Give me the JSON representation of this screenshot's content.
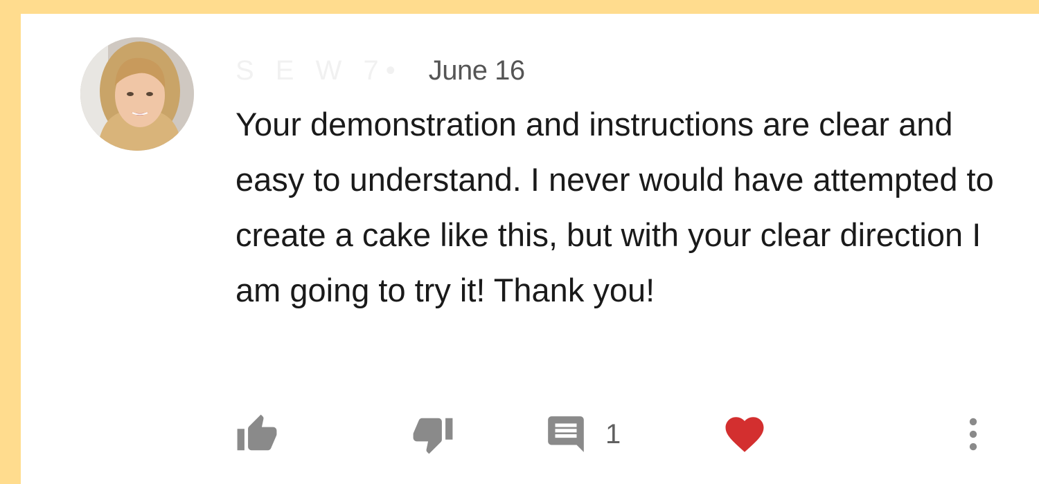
{
  "comment": {
    "author": "S E W 7",
    "separator": "•",
    "date": "June 16",
    "text": "Your demonstration and instructions are clear and easy to understand. I never would have attempted to create a cake like this, but with your clear direction I am going to try it! Thank you!",
    "reply_count": "1"
  },
  "icons": {
    "like": "thumbs-up-icon",
    "dislike": "thumbs-down-icon",
    "reply": "comment-icon",
    "heart": "heart-icon",
    "more": "more-vertical-icon"
  },
  "colors": {
    "background": "#FFDC8E",
    "card": "#ffffff",
    "icon_gray": "#8a8a8a",
    "heart_red": "#D32F2F",
    "date_text": "#555555",
    "body_text": "#1a1a1a"
  }
}
